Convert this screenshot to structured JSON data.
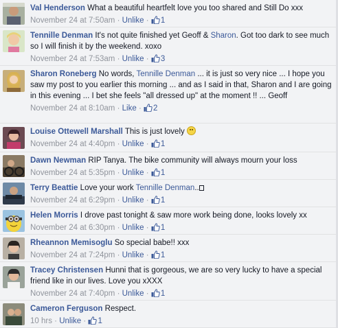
{
  "comments": [
    {
      "author": "Val Henderson",
      "text": "What a beautiful heartfelt love you too shared and Still Do xxx",
      "time": "November 24 at 7:50am",
      "like_label": "Unlike",
      "likes": "1"
    },
    {
      "author": "Tennille Denman",
      "text_a": "It's not quite finished yet Geoff & ",
      "mention": "Sharon",
      "text_b": ". Got too dark to see much so I will finish it by the weekend. xoxo",
      "time": "November 24 at 7:53am",
      "like_label": "Unlike",
      "likes": "3"
    },
    {
      "author": "Sharon Roneberg",
      "text_a": "No words, ",
      "mention": "Tennille Denman",
      "text_b": " ... it is just so very nice ... I hope you saw my post to you earlier this morning ... and as I said in that, Sharon and I are going in this evening ... I bet she feels \"all dressed up\" at the moment !! ... Geoff",
      "time": "November 24 at 8:10am",
      "like_label": "Like",
      "likes": "2"
    },
    {
      "author": "Louise Ottewell Marshall",
      "text": "This is just lovely",
      "time": "November 24 at 4:40pm",
      "like_label": "Unlike",
      "likes": "1"
    },
    {
      "author": "Dawn Newman",
      "text": "RIP Tanya. The bike community will always mourn your loss",
      "time": "November 24 at 5:35pm",
      "like_label": "Unlike",
      "likes": "1"
    },
    {
      "author": "Terry Beattie",
      "text_a": "Love your work ",
      "mention": "Tennille Denman",
      "text_b": "..",
      "time": "November 24 at 6:29pm",
      "like_label": "Unlike",
      "likes": "1"
    },
    {
      "author": "Helen Morris",
      "text": "I drove past tonight & saw more work being done, looks lovely xx",
      "time": "November 24 at 6:30pm",
      "like_label": "Unlike",
      "likes": "1"
    },
    {
      "author": "Rheannon Memisoglu",
      "text": "So special babe!! xxx",
      "time": "November 24 at 7:24pm",
      "like_label": "Unlike",
      "likes": "1"
    },
    {
      "author": "Tracey Christensen",
      "text": "Hunni that is gorgeous, we are so very lucky to have a special friend like in our lives. Love you xXXX",
      "time": "November 24 at 7:40pm",
      "like_label": "Unlike",
      "likes": "1"
    },
    {
      "author": "Cameron Ferguson",
      "text": "Respect.",
      "time": "10 hrs",
      "like_label": "Unlike",
      "likes": "1"
    }
  ],
  "meta_separator": "·",
  "icons": {
    "like": "thumbs-up-icon",
    "emoji": "smiley-icon"
  },
  "colors": {
    "link": "#3b5998",
    "meta": "#90949c",
    "background": "#f2f3f5"
  }
}
